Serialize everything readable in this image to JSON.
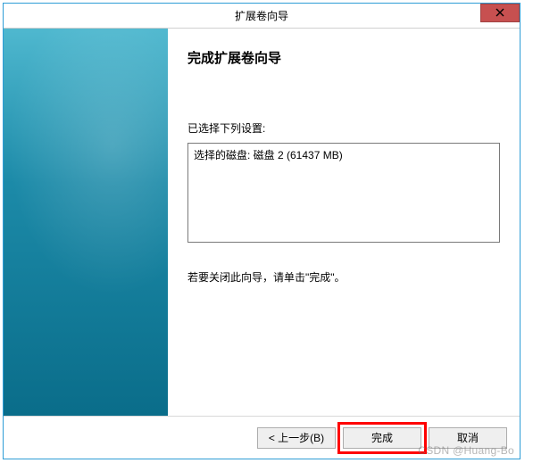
{
  "window": {
    "title": "扩展卷向导"
  },
  "content": {
    "heading": "完成扩展卷向导",
    "settings_label": "已选择下列设置:",
    "settings_text": "选择的磁盘: 磁盘 2 (61437 MB)",
    "instruction": "若要关闭此向导，请单击\"完成\"。"
  },
  "buttons": {
    "back": "< 上一步(B)",
    "finish": "完成",
    "cancel": "取消"
  },
  "watermark": "CSDN @Huang-Bo"
}
